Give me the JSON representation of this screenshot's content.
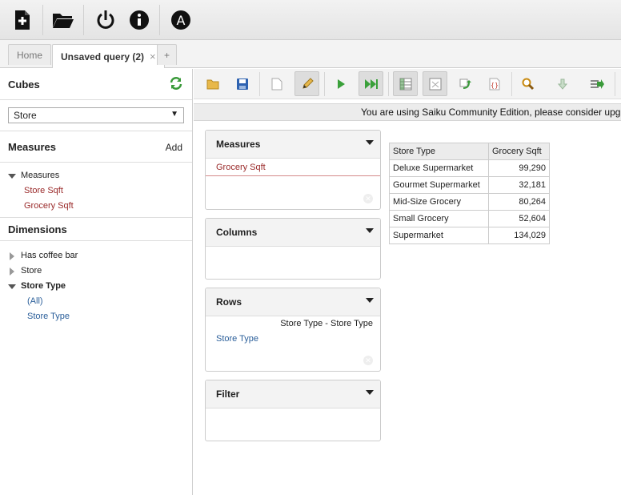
{
  "topbar": {
    "buttons": [
      {
        "name": "new-query-icon"
      },
      {
        "name": "open-query-icon"
      },
      {
        "name": "logout-icon"
      },
      {
        "name": "about-icon"
      },
      {
        "name": "admin-icon",
        "glyph": "A"
      }
    ]
  },
  "tabs": [
    {
      "label": "Home",
      "active": false
    },
    {
      "label": "Unsaved query (2)",
      "active": true,
      "close": "×"
    },
    {
      "label": "+",
      "active": false
    }
  ],
  "sidebar": {
    "cubes_title": "Cubes",
    "cube_selected": "Store",
    "measures_title": "Measures",
    "measures_add": "Add",
    "measures_group": "Measures",
    "measures": [
      "Store Sqft",
      "Grocery Sqft"
    ],
    "dimensions_title": "Dimensions",
    "dimensions": [
      {
        "label": "Has coffee bar",
        "expanded": false
      },
      {
        "label": "Store",
        "expanded": false
      },
      {
        "label": "Store Type",
        "expanded": true,
        "children": [
          "(All)",
          "Store Type"
        ]
      }
    ]
  },
  "notice": "You are using Saiku Community Edition, please consider upgrading",
  "panels": {
    "measures": {
      "title": "Measures",
      "items": [
        "Grocery Sqft"
      ]
    },
    "columns": {
      "title": "Columns",
      "items": []
    },
    "rows": {
      "title": "Rows",
      "hierarchy": "Store Type - Store Type",
      "items": [
        "Store Type"
      ]
    },
    "filter": {
      "title": "Filter",
      "items": []
    }
  },
  "result_table": {
    "headers": [
      "Store Type",
      "Grocery Sqft"
    ],
    "rows": [
      [
        "Deluxe Supermarket",
        "99,290"
      ],
      [
        "Gourmet Supermarket",
        "32,181"
      ],
      [
        "Mid-Size Grocery",
        "80,264"
      ],
      [
        "Small Grocery",
        "52,604"
      ],
      [
        "Supermarket",
        "134,029"
      ]
    ]
  },
  "colors": {
    "measure": "#9a2a2a",
    "dimension": "#2b5f9a",
    "refresh": "#3a9a3a"
  }
}
